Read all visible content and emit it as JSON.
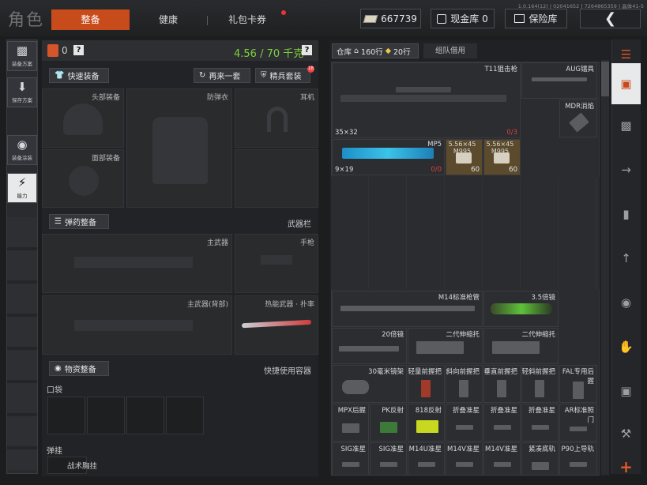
{
  "title": "角色",
  "tabs": [
    {
      "label": "整备"
    },
    {
      "label": "健康"
    },
    {
      "label": "礼包卡券"
    }
  ],
  "currency": {
    "amount": "667739"
  },
  "cash_vault": {
    "label": "现金库 0"
  },
  "safe": {
    "label": "保险库"
  },
  "version": "1.0.164(12) | 02041652 | 7264865359 | 晶体41-5",
  "left_sidebar": [
    {
      "label": "装备方案"
    },
    {
      "label": "保存方案"
    },
    {
      "label": "装备涂装"
    },
    {
      "label": "能力"
    }
  ],
  "loadout": {
    "capacity_current": "0",
    "weight": "4.56 / 70 千克",
    "help": "?",
    "quick_equip": "快速装备",
    "again": "再来一套",
    "elite": "精兵套装",
    "elite_badge": "18",
    "head": "头部装备",
    "armor": "防弹衣",
    "ear": "耳机",
    "face": "面部装备",
    "ammo_btn": "弹药整备",
    "weapon_bar": "武器栏",
    "primary": "主武器",
    "pistol": "手枪",
    "primary_back": "主武器(背部)",
    "melee": "热能武器 · 扑率",
    "supply_btn": "物资整备",
    "quick_use": "快捷使用容器",
    "pocket": "口袋",
    "rig": "弹挂",
    "rig_item": "战术胸挂"
  },
  "storage": {
    "label": "仓库",
    "rows1": "160行",
    "rows2": "20行",
    "squad": "组队借用",
    "items": [
      {
        "name": "T11狙击枪",
        "caliber": "35×32",
        "count": "0/3"
      },
      {
        "name": "AUG镭具"
      },
      {
        "name": "MDR消焰"
      },
      {
        "name": "MP5",
        "caliber": "9×19",
        "count": "0/0"
      },
      {
        "name": "5.56×45 M995",
        "count": "60"
      },
      {
        "name": "5.56×45 M995",
        "count": "60"
      },
      {
        "name": "M14标准枪管"
      },
      {
        "name": "3.5倍镜"
      },
      {
        "name": "20倍镜"
      },
      {
        "name": "二代伸缩托"
      },
      {
        "name": "二代伸缩托"
      },
      {
        "name": "30毫米镜架"
      },
      {
        "name": "轻量前握把"
      },
      {
        "name": "斜向前握把"
      },
      {
        "name": "垂直前握把"
      },
      {
        "name": "轻斜前握把"
      },
      {
        "name": "FAL专用后握"
      },
      {
        "name": "MPX后握"
      },
      {
        "name": "PK反射"
      },
      {
        "name": "818反射"
      },
      {
        "name": "折叠准星"
      },
      {
        "name": "折叠准星"
      },
      {
        "name": "折叠准星"
      },
      {
        "name": "AR标准照门"
      },
      {
        "name": "SIG准星"
      },
      {
        "name": "SIG准星"
      },
      {
        "name": "M14U准星"
      },
      {
        "name": "M14V准星"
      },
      {
        "name": "M14V准星"
      },
      {
        "name": "紧凑底轨"
      },
      {
        "name": "P90上导轨"
      }
    ]
  },
  "colors": {
    "accent": "#c84b1c",
    "weight": "#7fd13b",
    "danger": "#d8403a"
  }
}
